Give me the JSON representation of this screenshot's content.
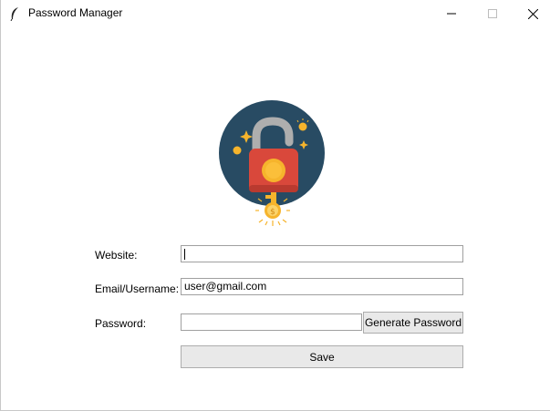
{
  "window": {
    "title": "Password Manager",
    "controls": [
      "minimize",
      "maximize",
      "close"
    ]
  },
  "logo": {
    "icon": "padlock-logo-icon",
    "colors": {
      "circle": "#284b63",
      "lock_body": "#d9483b",
      "shackle": "#b0b0b0",
      "keyhole": "#f6b42c",
      "coin": "#f6b42c"
    }
  },
  "form": {
    "website_label": "Website:",
    "website_value": "",
    "email_label": "Email/Username:",
    "email_value": "user@gmail.com",
    "password_label": "Password:",
    "password_value": "",
    "generate_label": "Generate Password",
    "save_label": "Save"
  }
}
